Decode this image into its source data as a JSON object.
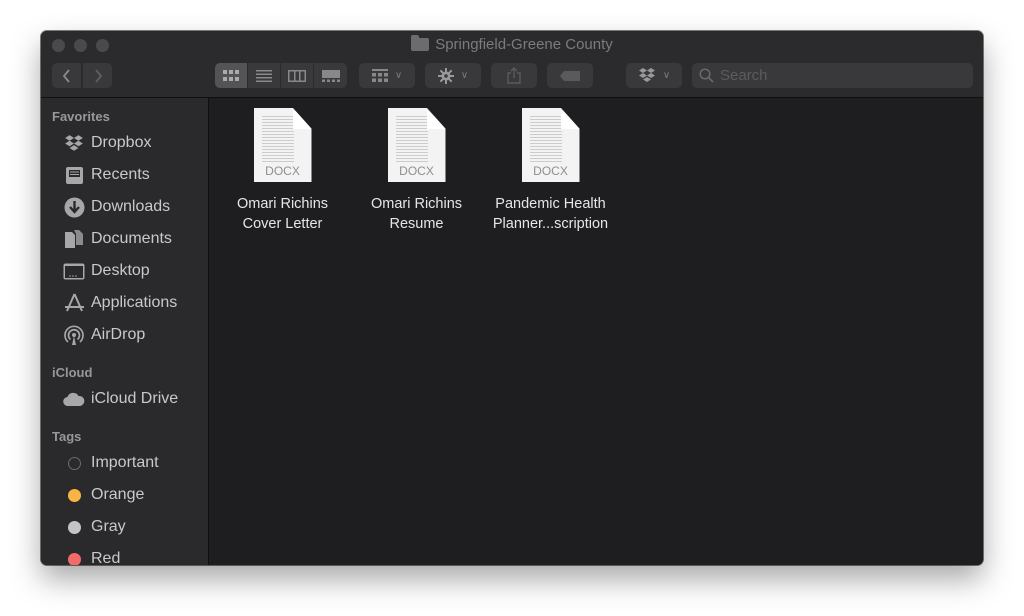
{
  "window": {
    "title": "Springfield-Greene County"
  },
  "toolbar": {
    "back_icon": "chevron-left-icon",
    "forward_icon": "chevron-right-icon",
    "view_modes": [
      "icon-view",
      "list-view",
      "column-view",
      "gallery-view"
    ],
    "active_view": "icon-view",
    "group_by_icon": "grid-icon",
    "action_icon": "gear-icon",
    "share_icon": "share-icon",
    "tag_icon": "tag-icon",
    "dropbox_icon": "dropbox-icon",
    "search": {
      "placeholder": "Search",
      "value": ""
    }
  },
  "sidebar": {
    "sections": [
      {
        "title": "Favorites",
        "items": [
          {
            "label": "Dropbox",
            "icon": "dropbox-icon"
          },
          {
            "label": "Recents",
            "icon": "recents-icon"
          },
          {
            "label": "Downloads",
            "icon": "downloads-icon"
          },
          {
            "label": "Documents",
            "icon": "documents-icon"
          },
          {
            "label": "Desktop",
            "icon": "desktop-icon"
          },
          {
            "label": "Applications",
            "icon": "applications-icon"
          },
          {
            "label": "AirDrop",
            "icon": "airdrop-icon"
          }
        ]
      },
      {
        "title": "iCloud",
        "items": [
          {
            "label": "iCloud Drive",
            "icon": "cloud-icon"
          }
        ]
      },
      {
        "title": "Tags",
        "items": [
          {
            "label": "Important",
            "color": "#2a2a2c",
            "outline": true
          },
          {
            "label": "Orange",
            "color": "#f9b543"
          },
          {
            "label": "Gray",
            "color": "#c4c4c6"
          },
          {
            "label": "Red",
            "color": "#f26b6b"
          }
        ]
      }
    ]
  },
  "files": [
    {
      "name_line1": "Omari Richins",
      "name_line2": "Cover Letter",
      "type": "DOCX"
    },
    {
      "name_line1": "Omari Richins",
      "name_line2": "Resume",
      "type": "DOCX"
    },
    {
      "name_line1": "Pandemic Health",
      "name_line2": "Planner...scription",
      "type": "DOCX"
    }
  ]
}
